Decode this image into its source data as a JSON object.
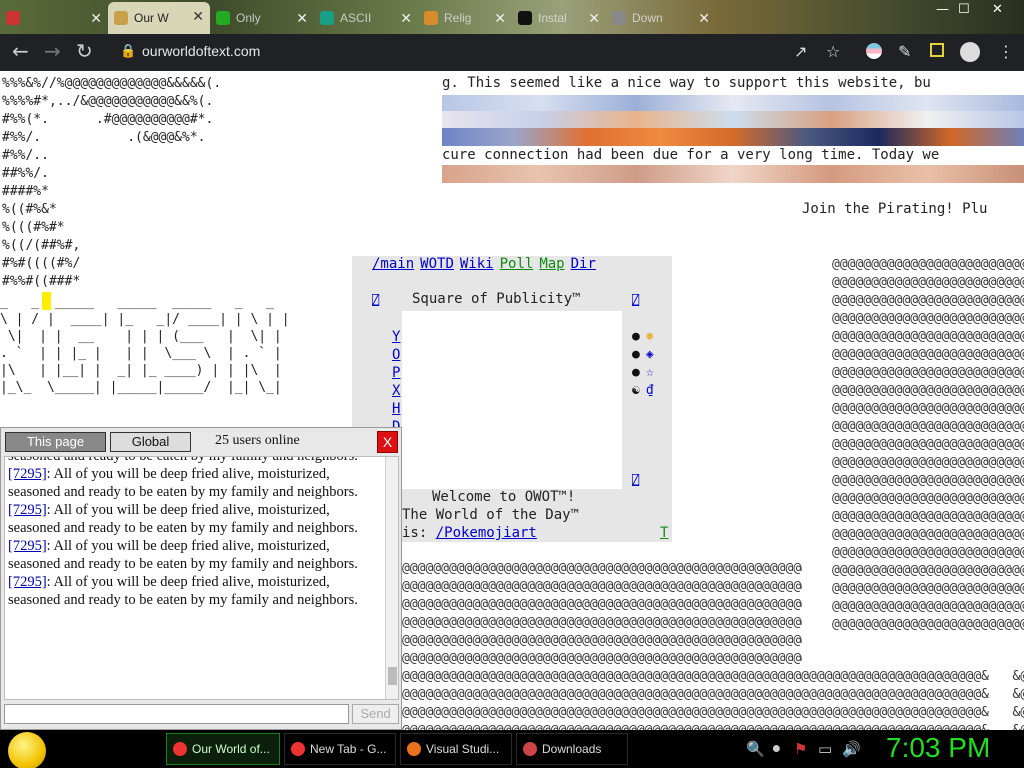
{
  "tabs": [
    {
      "label": "",
      "icon": "chrome-icon",
      "color": "#c33"
    },
    {
      "label": "Our W",
      "icon": "owot-icon",
      "color": "#c9a04a",
      "active": true
    },
    {
      "label": "Only",
      "icon": "download-icon",
      "color": "#2a2"
    },
    {
      "label": "ASCII",
      "icon": "grammarly-icon",
      "color": "#16a085"
    },
    {
      "label": "Relig",
      "icon": "book-icon",
      "color": "#d98a2a"
    },
    {
      "label": "Instal",
      "icon": "github-icon",
      "color": "#111"
    },
    {
      "label": "Down",
      "icon": "page-icon",
      "color": "#888"
    }
  ],
  "window_controls": {
    "minimize": "—",
    "maximize": "☐",
    "close": "✕"
  },
  "address": {
    "url": "ourworldoftext.com"
  },
  "page": {
    "ascii_top": "%%%&%//%@@@@@@@@@@@@@&&&&&(.\n%%%%#*,../&@@@@@@@@@@@&&%(.\n#%%(*.      .#@@@@@@@@@@#*.\n#%%/.           .(&@@@&%*.\n#%%/..\n##%%/.\n####%*\n%((#%&*\n%(((#%#*\n%((/(##%#,\n#%#((((#%/\n#%%#((###*",
    "banner": "_   _  _____   _____  _____   _   _\n\\ | / |  ____| |_   _|/ ____| | \\ | |\n \\|  | |  __    | | | (___   |  \\| |\n. `  | | |_ |   | |  \\___ \\  | . ` |\n|\\   | |__| |  _| |_ ____) | | |\\  |\n|_\\_  \\_____| |_____|_____/  |_| \\_|",
    "wide_text_1": "g. This seemed like a nice way to support this website, bu",
    "wide_text_2": "cure connection had been due for a very long time. Today we",
    "pirating": "Join the Pirating! Plu",
    "panel": {
      "nav": [
        {
          "label": "/main",
          "style": "blue"
        },
        {
          "label": "WOTD",
          "style": "blue"
        },
        {
          "label": "Wiki",
          "style": "blue"
        },
        {
          "label": "Poll",
          "style": "green"
        },
        {
          "label": "Map",
          "style": "green"
        },
        {
          "label": "Dir",
          "style": "blue"
        }
      ],
      "square_title": "Square of Publicity™",
      "box_glyph": "⍁",
      "letters": [
        "Y",
        "O",
        "P",
        "X",
        "H",
        "D"
      ],
      "symbols_left": [
        "●",
        "●",
        "●",
        "☯"
      ],
      "symbols_right": [
        "❅",
        "◈",
        "☆",
        "₫"
      ],
      "welcome": "Welcome to OWOT™!",
      "wotd_label": "The World of the Day™",
      "wotd_is": "is: ",
      "wotd_link": "/Pokemojiart",
      "t_link": "T"
    },
    "at_row": "@@@@@@@@@@@@@@@@@@@@@@@@@@@@@@@@@@@@@@@@@@@@@@@@@@@@@@@@@@",
    "at_row_tail": "@@@@@@@@@@@@@@@@@@@@@@@@@@@@@@@@@@@@@@@@@@@@@@@@@@@@@@@@@@@@@@@@@@@@@@@@@@&   &@"
  },
  "chat": {
    "tab_this": "This page",
    "tab_global": "Global",
    "online": "25 users online",
    "close": "X",
    "partial_top": "seasoned and ready to be eaten by my family and neighbors.",
    "messages": [
      {
        "uid": "[7295]",
        "text": ": All of you will be deep fried alive, moisturized, seasoned and ready to be eaten by my family and neighbors."
      },
      {
        "uid": "[7295]",
        "text": ": All of you will be deep fried alive, moisturized, seasoned and ready to be eaten by my family and neighbors."
      },
      {
        "uid": "[7295]",
        "text": ": All of you will be deep fried alive, moisturized, seasoned and ready to be eaten by my family and neighbors."
      },
      {
        "uid": "[7295]",
        "text": ": All of you will be deep fried alive, moisturized, seasoned and ready to be eaten by my family and neighbors."
      }
    ],
    "send": "Send"
  },
  "taskbar": {
    "buttons": [
      {
        "label": "Our World of...",
        "icon": "chrome-icon",
        "color": "#e33",
        "active": true
      },
      {
        "label": "New Tab - G...",
        "icon": "chrome-icon",
        "color": "#e33"
      },
      {
        "label": "Visual Studi...",
        "icon": "firefox-icon",
        "color": "#e8731a"
      },
      {
        "label": "Downloads",
        "icon": "folder-icon",
        "color": "#c44"
      }
    ],
    "clock": "7:03 PM"
  }
}
